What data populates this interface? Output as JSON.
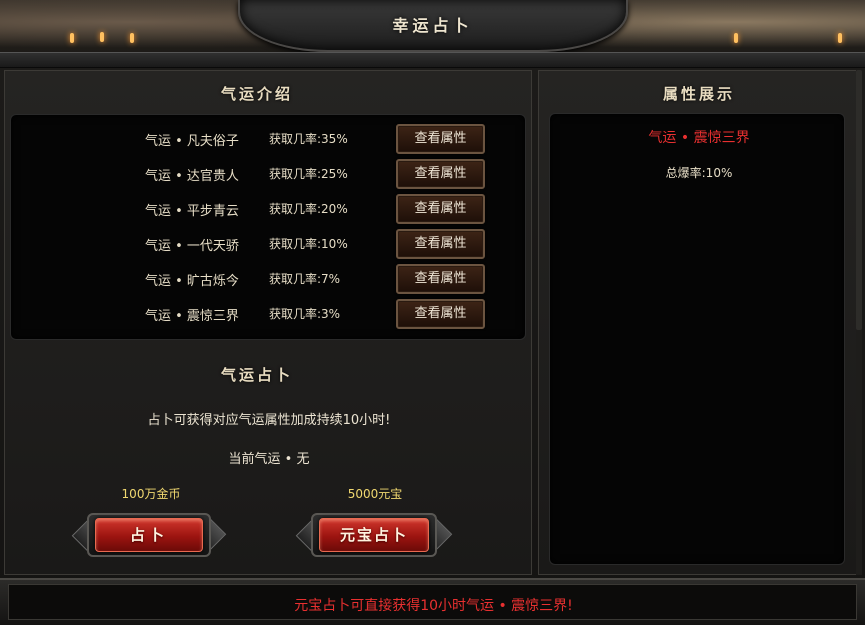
{
  "window": {
    "title": "幸运占卜"
  },
  "intro": {
    "title": "气运介绍",
    "view_label": "查看属性",
    "rows": [
      {
        "name": "气运 • 凡夫俗子",
        "rate": "获取几率:35%"
      },
      {
        "name": "气运 • 达官贵人",
        "rate": "获取几率:25%"
      },
      {
        "name": "气运 • 平步青云",
        "rate": "获取几率:20%"
      },
      {
        "name": "气运 • 一代天骄",
        "rate": "获取几率:10%"
      },
      {
        "name": "气运 • 旷古烁今",
        "rate": "获取几率:7%"
      },
      {
        "name": "气运 • 震惊三界",
        "rate": "获取几率:3%"
      }
    ]
  },
  "divination": {
    "title": "气运占卜",
    "description": "占卜可获得对应气运属性加成持续10小时!",
    "current": "当前气运 • 无",
    "gold_cost": "100万金币",
    "gold_button": "占卜",
    "ingot_cost": "5000元宝",
    "ingot_button": "元宝占卜"
  },
  "attributes": {
    "title": "属性展示",
    "selected_name": "气运 • 震惊三界",
    "selected_value": "总爆率:10%"
  },
  "footer": {
    "notice": "元宝占卜可直接获得10小时气运 • 震惊三界!"
  },
  "colors": {
    "highlight_red": "#e83030",
    "cost_yellow": "#f0d870",
    "text_light": "#e6ddc6"
  }
}
